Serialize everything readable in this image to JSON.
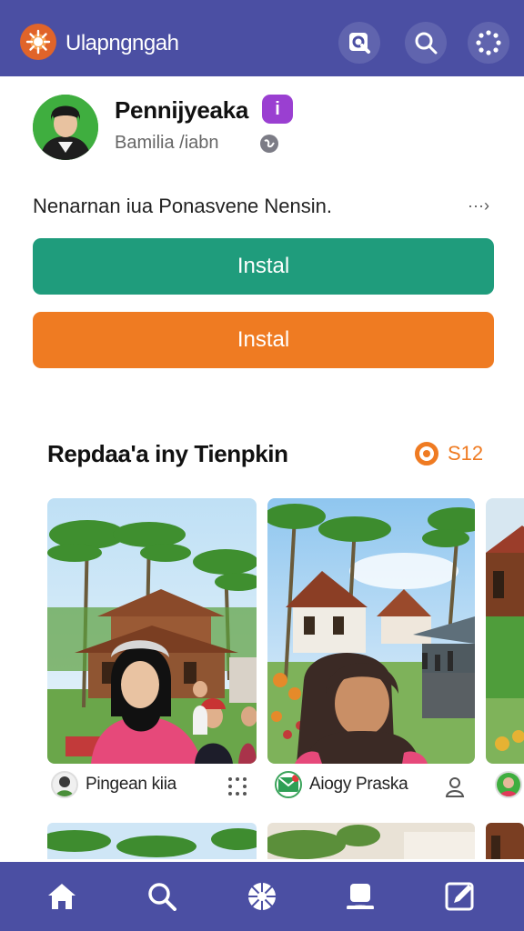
{
  "header": {
    "app_title": "Ulapngngah",
    "logo_icon": "sun-logo-icon",
    "actions": [
      {
        "icon": "camera-search-icon"
      },
      {
        "icon": "search-icon"
      },
      {
        "icon": "dots-circle-icon"
      }
    ]
  },
  "profile": {
    "name": "Pennijyeaka",
    "badge": "i",
    "subtitle": "Bamilia /iabn",
    "description": "Nenarnan iua Ponasvene Nensin.",
    "more_label": "···›"
  },
  "buttons": {
    "primary_label": "Instal",
    "secondary_label": "Instal"
  },
  "section": {
    "title": "Repdaa'a iny Tienpkin",
    "count": "S12"
  },
  "cards": [
    {
      "author": "Pingean kiia",
      "action_icon": "grid-dots-icon"
    },
    {
      "author": "Aiogy Praska",
      "action_icon": "person-icon"
    }
  ],
  "bottom_nav": [
    {
      "icon": "home-icon"
    },
    {
      "icon": "search-icon"
    },
    {
      "icon": "aperture-icon"
    },
    {
      "icon": "profile-card-icon"
    },
    {
      "icon": "edit-icon"
    }
  ],
  "colors": {
    "bar": "#4b4fa3",
    "primary_button": "#1f9c7c",
    "secondary_button": "#ef7b22",
    "badge": "#9a3fd1"
  }
}
